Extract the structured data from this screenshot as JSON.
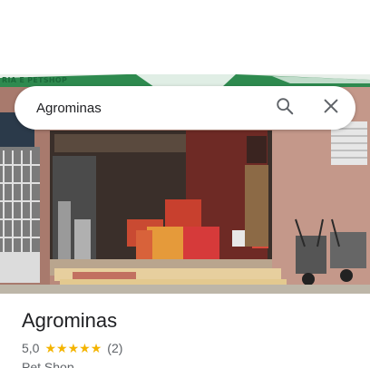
{
  "photo": {
    "sign_text": "RIA E PETSHOP"
  },
  "search": {
    "value": "Agrominas",
    "search_icon": "search-icon",
    "close_icon": "close-icon"
  },
  "place": {
    "name": "Agrominas",
    "rating": "5,0",
    "stars_count": 5,
    "review_count": "(2)",
    "category": "Pet Shop"
  },
  "colors": {
    "star": "#f4b400",
    "text_primary": "#202124",
    "text_secondary": "#5f6368"
  }
}
